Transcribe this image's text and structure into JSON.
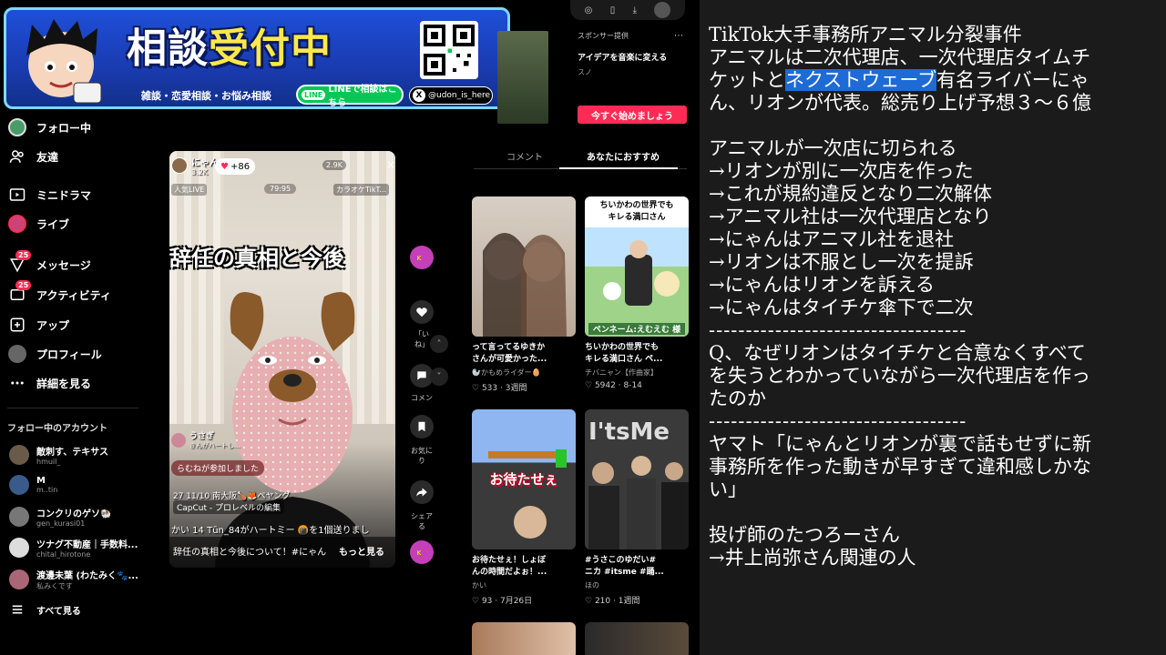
{
  "banner": {
    "title_a": "相談",
    "title_b": "受付中",
    "subtitle": "雑談・恋愛相談・お悩み相談",
    "line_label": "LINEで相談はこちら",
    "line_badge": "LINE",
    "x_handle": "@udon_is_here",
    "x_logo": "X"
  },
  "sidebar": {
    "items": [
      {
        "label": "フォロー中",
        "icon": "following-avatar-icon"
      },
      {
        "label": "友達",
        "icon": "friends-icon"
      },
      {
        "label": "ミニドラマ",
        "icon": "mini-drama-icon"
      },
      {
        "label": "ライブ",
        "icon": "live-icon"
      },
      {
        "label": "メッセージ",
        "icon": "message-icon",
        "badge": "25"
      },
      {
        "label": "アクティビティ",
        "icon": "activity-icon",
        "badge": "25"
      },
      {
        "label": "アップ",
        "icon": "upload-icon"
      },
      {
        "label": "プロフィール",
        "icon": "profile-icon"
      },
      {
        "label": "詳細を見る",
        "icon": "more-icon"
      }
    ],
    "following_header": "フォロー中のアカウント",
    "accounts": [
      {
        "name": "敵刺す、テキサス",
        "id": "hmuil_",
        "color": "#6a5a4a"
      },
      {
        "name": "M",
        "id": "m..tin",
        "color": "#3a5a8a"
      },
      {
        "name": "コンクリのゲソ🐏",
        "id": "gen_kurasi01",
        "color": "#777777"
      },
      {
        "name": "ツナグ不動産｜手数料...",
        "id": "chital_hirotone",
        "color": "#dddddd"
      },
      {
        "name": "渡邊未葉 (わたみく🐾...",
        "id": "私みくです",
        "color": "#aa6677"
      }
    ],
    "see_all": "すべて見る"
  },
  "video": {
    "host_name": "にゃん",
    "host_count": "3.2K",
    "likes": "+86",
    "viewers": "2.9K",
    "popular_tag": "人気LIVE",
    "score_tag": "79:95",
    "karaoke_tag": "カラオケTikT...",
    "headline": "辞任の真相と今後",
    "chat_name": "うさぎ",
    "chat_text": "きんがハートし...",
    "join_text": "らむねが参加しました",
    "gift_row": "27 11/10 南大阪🍗🦊ペヤング",
    "capcut": "CapCut - プロレベルの編集",
    "gift_row2": "かい 14 Tūn_84がハートミー 🍘を1個送りまし",
    "caption": "辞任の真相と今後について！#にゃん",
    "more": "もっと見る",
    "close": "×"
  },
  "rail": {
    "like_label": "「い\nね」",
    "comment_label": "コメン",
    "save_label": "お気に\nり",
    "share_label": "シェア\nる"
  },
  "top_controls": {
    "icons": [
      "pip-icon",
      "mobile-icon",
      "download-icon",
      "user-avatar-icon"
    ]
  },
  "sponsor": {
    "label": "スポンサー提供",
    "more": "⋯",
    "title": "アイデアを音楽に変える",
    "brand": "スノ",
    "cta": "今すぐ始めましょう"
  },
  "tabs": {
    "comments": "コメント",
    "recommend": "あなたにおすすめ"
  },
  "recs": [
    {
      "caption": "って言ってるゆきか\nさんが可愛かった...",
      "author": "🦭かもめライダー🥚",
      "likes": "533",
      "age": "3週間",
      "thumb_color": "#c8bdb2"
    },
    {
      "caption": "ちいかわの世界でも\nキレる満口さん ペ...",
      "author": "チバニャン【作曲家】",
      "likes": "5942",
      "age": "8-14",
      "thumb_color": "#b8d8a8",
      "overlay_top": "ちいかわの世界でも\nキレる満口さん",
      "overlay_bottom": "ペンネーム:えむえむ 様"
    },
    {
      "caption": "お待たせぇ！しょぼ\nんの時間だよぉ！...",
      "author": "かい",
      "likes": "93",
      "age": "7月26日",
      "thumb_color": "#8fb6f0",
      "overlay_mid": "お待たせぇ"
    },
    {
      "caption": "#うさこのゆだい#\nニカ #itsme #踊...",
      "author": "ほの",
      "likes": "210",
      "age": "1週間",
      "thumb_color": "#3a3a3a",
      "overlay_top": "I'tsMe"
    }
  ],
  "notes": {
    "lines": [
      "TikTok大手事務所アニマル分裂事件",
      "アニマルは二次代理店、一次代理店タイムチ",
      "ケットと|ネクストウェーブ|有名ライバーにゃ",
      "ん、リオンが代表。総売り上げ予想３～６億",
      "",
      "アニマルが一次店に切られる",
      "→リオンが別に一次店を作った",
      "→これが規約違反となり二次解体",
      "→アニマル社は一次代理店となり",
      "→にゃんはアニマル社を退社",
      "→リオンは不服とし一次を提訴",
      "→にゃんはリオンを訴える",
      "→にゃんはタイチケ傘下で二次",
      "-----------------------------------",
      "Q、なぜリオンはタイチケと合意なくすべて",
      "を失うとわかっていながら一次代理店を作っ",
      "たのか",
      "-----------------------------------",
      "ヤマト「にゃんとリオンが裏で話もせずに新",
      "事務所を作った動きが早すぎて違和感しかな",
      "い」",
      "",
      "投げ師のたつろーさん",
      "→井上尚弥さん関連の人"
    ]
  }
}
